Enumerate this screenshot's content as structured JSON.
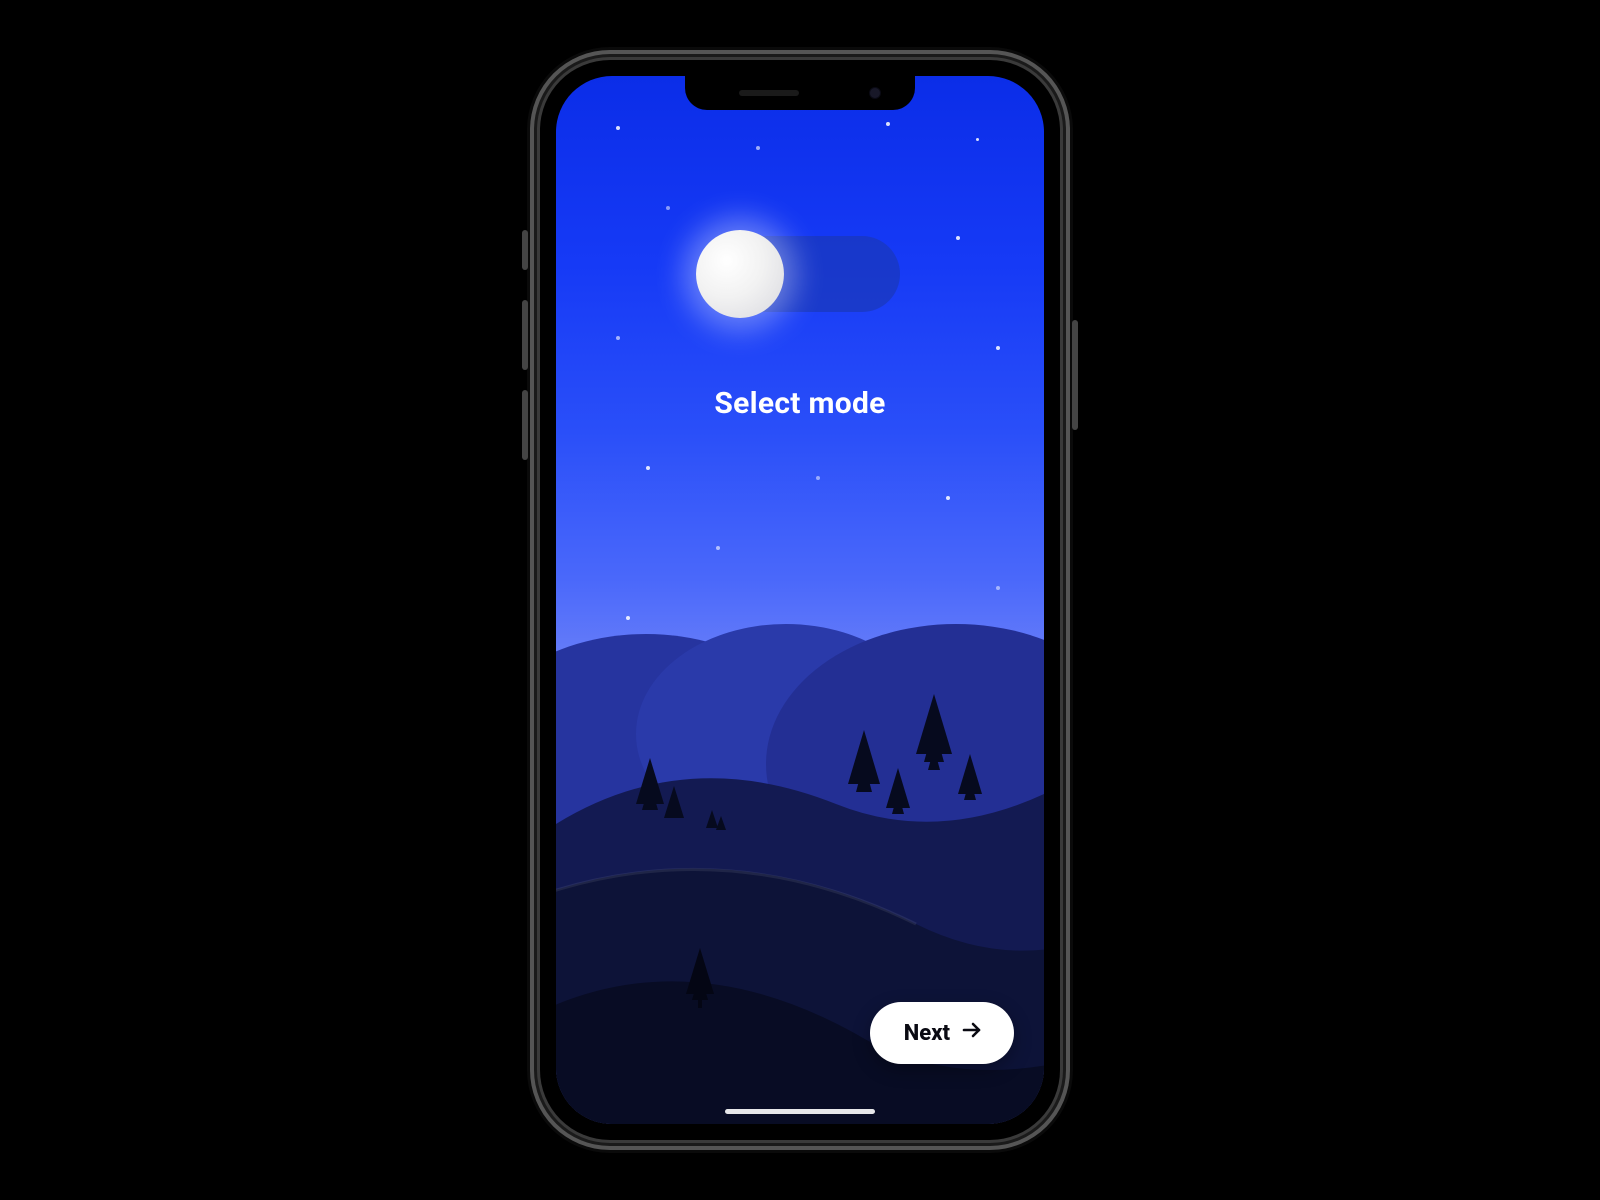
{
  "heading": "Select mode",
  "toggle": {
    "state": "off"
  },
  "next": {
    "label": "Next"
  },
  "colors": {
    "sky_top": "#0b2de8",
    "hill_back": "#1c2b8f",
    "hill_mid": "#151e54",
    "hill_front": "#0c1230",
    "button_bg": "#ffffff"
  }
}
